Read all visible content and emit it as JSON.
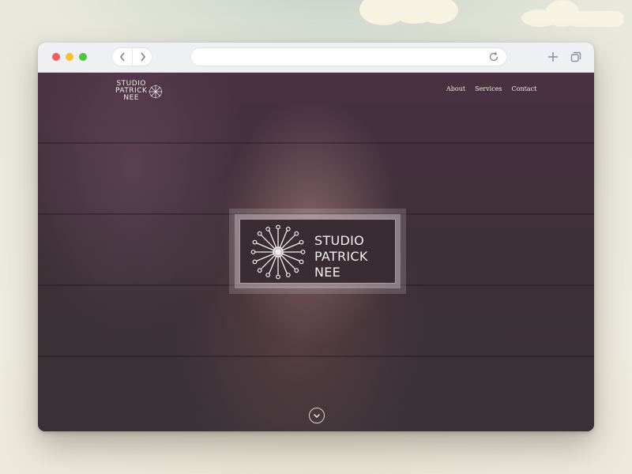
{
  "browser": {
    "back_icon": "chevron-left-icon",
    "forward_icon": "chevron-right-icon",
    "url": "",
    "reload_icon": "reload-icon",
    "new_tab_icon": "plus-icon",
    "tabs_icon": "tabs-icon"
  },
  "site": {
    "logo": {
      "line1": "STUDIO",
      "line2": "PATRICK",
      "line3": "NEE"
    },
    "nav": [
      {
        "label": "About"
      },
      {
        "label": "Services"
      },
      {
        "label": "Contact"
      }
    ],
    "hero_badge": {
      "line1": "STUDIO",
      "line2": "PATRICK",
      "line3": "NEE"
    },
    "scroll_icon": "chevron-down-icon"
  },
  "colors": {
    "close": "#f25e57",
    "minimize": "#f6c12f",
    "maximize": "#4fc53c",
    "chrome_bg": "#eef0f4",
    "hero_overlay": "#3a2c33"
  }
}
